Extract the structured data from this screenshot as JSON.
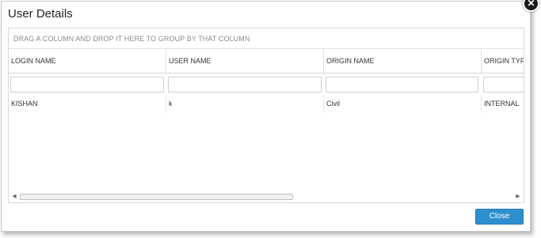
{
  "dialog": {
    "title": "User Details",
    "close_icon_glyph": "✕"
  },
  "grid": {
    "group_panel_hint": "DRAG A COLUMN AND DROP IT HERE TO GROUP BY THAT COLUMN",
    "columns": [
      {
        "label": "LOGIN NAME"
      },
      {
        "label": "USER NAME"
      },
      {
        "label": "ORIGIN NAME"
      },
      {
        "label": "ORIGIN TYP"
      }
    ],
    "filters": [
      "",
      "",
      "",
      ""
    ],
    "rows": [
      [
        "KISHAN",
        "k",
        "Civil",
        "INTERNAL"
      ]
    ],
    "scroll_left_icon": "◀",
    "scroll_right_icon": "▶"
  },
  "footer": {
    "close_label": "Close"
  },
  "colors": {
    "accent": "#2d8fce",
    "border": "#d9d9d9"
  }
}
